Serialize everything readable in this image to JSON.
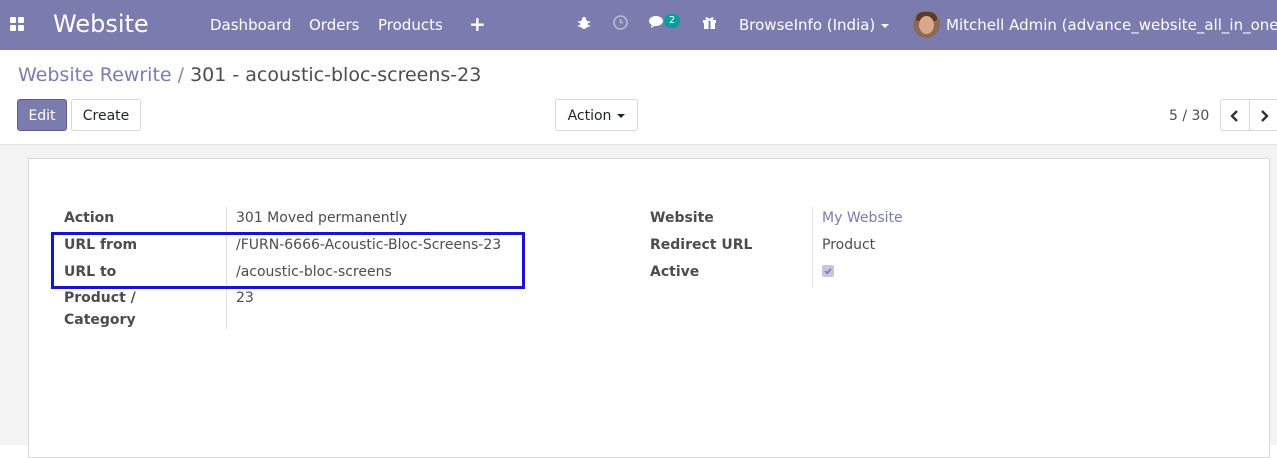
{
  "navbar": {
    "app_name": "Website",
    "menu": [
      "Dashboard",
      "Orders",
      "Products"
    ],
    "new_icon": "+",
    "message_count": "2",
    "company": "BrowseInfo (India)",
    "user": "Mitchell Admin (advance_website_all_in_one)",
    "color": "#7c7bad"
  },
  "breadcrumb": {
    "parent": "Website Rewrite",
    "separator": "/",
    "current": "301 - acoustic-bloc-screens-23"
  },
  "controls": {
    "edit": "Edit",
    "create": "Create",
    "action": "Action",
    "pager": "5 / 30"
  },
  "form": {
    "left": [
      {
        "label": "Action",
        "value": "301 Moved permanently"
      },
      {
        "label": "URL from",
        "value": "/FURN-6666-Acoustic-Bloc-Screens-23"
      },
      {
        "label": "URL to",
        "value": "/acoustic-bloc-screens"
      },
      {
        "label_line1": "Product /",
        "label_line2": "Category",
        "value": "23"
      }
    ],
    "right": [
      {
        "label": "Website",
        "value": "My Website"
      },
      {
        "label": "Redirect URL",
        "value": "Product"
      },
      {
        "label": "Active",
        "value": true
      }
    ]
  },
  "highlight_color": "#1414d2"
}
